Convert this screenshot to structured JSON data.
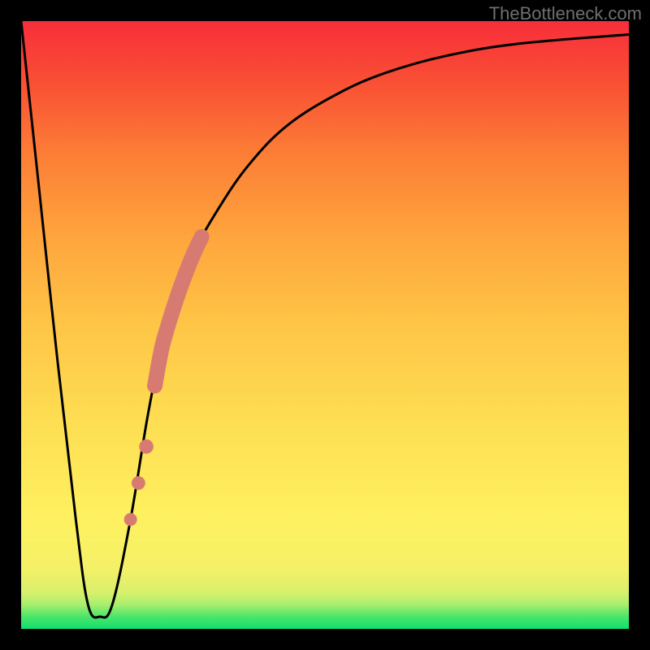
{
  "watermark": "TheBottleneck.com",
  "chart_data": {
    "type": "line",
    "title": "",
    "xlabel": "",
    "ylabel": "",
    "xlim": [
      0,
      100
    ],
    "ylim": [
      0,
      100
    ],
    "grid": false,
    "legend": false,
    "series": [
      {
        "name": "bottleneck-curve",
        "x": [
          0,
          3,
          6,
          9,
          11,
          13,
          15,
          18,
          21,
          24,
          28,
          33,
          38,
          44,
          52,
          60,
          70,
          82,
          100
        ],
        "y": [
          100,
          72,
          44,
          18,
          4,
          2,
          4,
          18,
          36,
          50,
          61,
          70,
          77,
          83,
          88,
          91.5,
          94.3,
          96.3,
          97.8
        ]
      }
    ],
    "markers": {
      "name": "highlight-segment",
      "color": "#d77b72",
      "style": "thick-rounded",
      "points_on_curve_x": [
        18,
        19.3,
        20.6,
        22,
        23.1,
        24.2,
        25.3,
        26.4,
        27.5,
        28.6,
        29.7
      ],
      "points_on_curve_y": [
        18,
        24,
        30,
        40,
        46,
        50,
        53.5,
        56.7,
        59.6,
        62.2,
        64.5
      ],
      "gap_indices": [
        1,
        3,
        5
      ]
    },
    "notes": "No axis ticks or numeric labels are visible; x/y values are estimated as percentages of the plot area so the shape can be reproduced. The curve drops steeply from top-left to a minimum near x≈12%, then rises asymptotically toward the top-right. A salmon-colored thick marker segment with a few separated beads sits on the rising limb between roughly x=18% and x=30%."
  }
}
